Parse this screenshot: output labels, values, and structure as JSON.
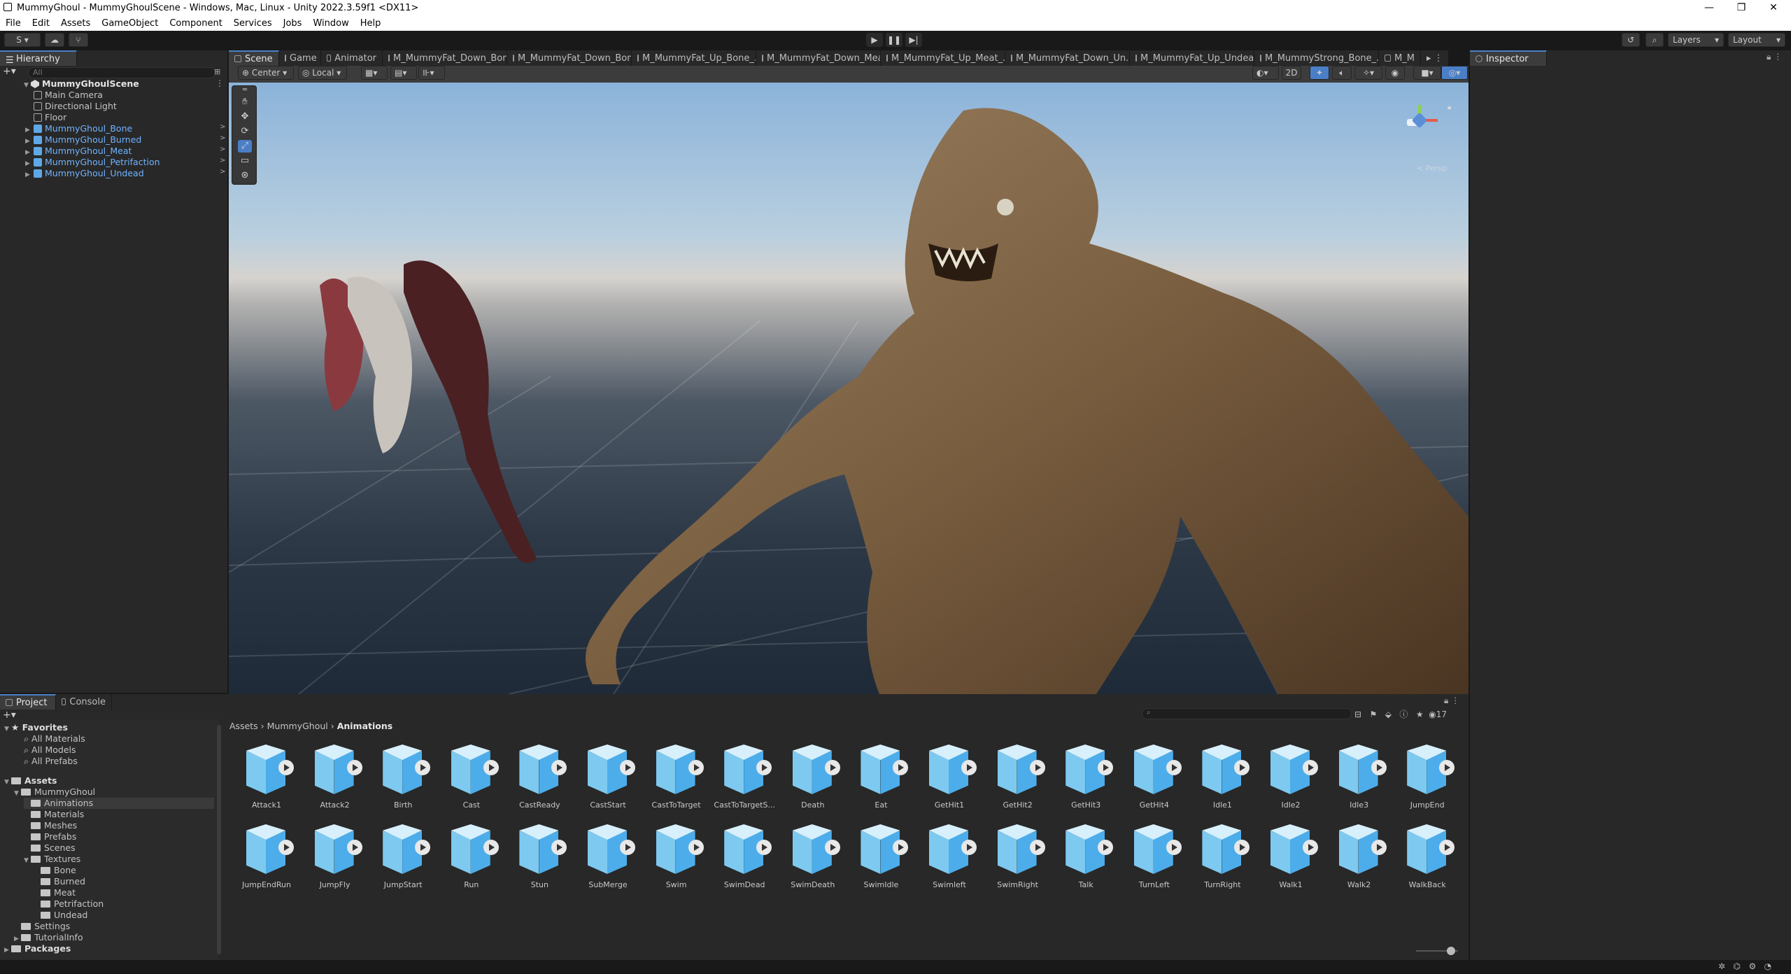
{
  "window": {
    "title": "MummyGhoul - MummyGhoulScene - Windows, Mac, Linux - Unity 2022.3.59f1 <DX11>",
    "controls": [
      "—",
      "❐",
      "✕"
    ]
  },
  "menu": [
    "File",
    "Edit",
    "Assets",
    "GameObject",
    "Component",
    "Services",
    "Jobs",
    "Window",
    "Help"
  ],
  "toolbar": {
    "account": "S",
    "layers_label": "Layers",
    "layout_label": "Layout"
  },
  "hierarchy": {
    "tab": "Hierarchy",
    "search_placeholder": "All",
    "scene_name": "MummyGhoulScene",
    "items": [
      {
        "label": "Main Camera",
        "type": "gameobject"
      },
      {
        "label": "Directional Light",
        "type": "gameobject"
      },
      {
        "label": "Floor",
        "type": "gameobject"
      },
      {
        "label": "MummyGhoul_Bone",
        "type": "prefab"
      },
      {
        "label": "MummyGhoul_Burned",
        "type": "prefab"
      },
      {
        "label": "MummyGhoul_Meat",
        "type": "prefab"
      },
      {
        "label": "MummyGhoul_Petrifaction",
        "type": "prefab"
      },
      {
        "label": "MummyGhoul_Undead",
        "type": "prefab"
      }
    ]
  },
  "scene_tabs": [
    {
      "label": "Scene",
      "active": true
    },
    {
      "label": "Game"
    },
    {
      "label": "Animator"
    },
    {
      "label": "M_MummyFat_Down_Bon..."
    },
    {
      "label": "M_MummyFat_Down_Bon..."
    },
    {
      "label": "M_MummyFat_Up_Bone_..."
    },
    {
      "label": "M_MummyFat_Down_Mea..."
    },
    {
      "label": "M_MummyFat_Up_Meat_..."
    },
    {
      "label": "M_MummyFat_Down_Un..."
    },
    {
      "label": "M_MummyFat_Up_Undea..."
    },
    {
      "label": "M_MummyStrong_Bone_..."
    },
    {
      "label": "M_M"
    }
  ],
  "scene_toolbar": {
    "pivot": "Center",
    "space": "Local",
    "mode_2d": "2D",
    "gizmo_label": "< Persp"
  },
  "inspector": {
    "tab": "Inspector"
  },
  "bottom_tabs": [
    {
      "label": "Project",
      "active": true
    },
    {
      "label": "Console"
    }
  ],
  "project_tree": {
    "favorites": {
      "label": "Favorites",
      "items": [
        "All Materials",
        "All Models",
        "All Prefabs"
      ]
    },
    "assets": {
      "label": "Assets",
      "items": [
        {
          "label": "MummyGhoul",
          "depth": 1
        },
        {
          "label": "Animations",
          "depth": 2,
          "selected": true
        },
        {
          "label": "Materials",
          "depth": 2
        },
        {
          "label": "Meshes",
          "depth": 2
        },
        {
          "label": "Prefabs",
          "depth": 2
        },
        {
          "label": "Scenes",
          "depth": 2
        },
        {
          "label": "Textures",
          "depth": 2
        },
        {
          "label": "Bone",
          "depth": 3
        },
        {
          "label": "Burned",
          "depth": 3
        },
        {
          "label": "Meat",
          "depth": 3
        },
        {
          "label": "Petrifaction",
          "depth": 3
        },
        {
          "label": "Undead",
          "depth": 3
        },
        {
          "label": "Settings",
          "depth": 1
        },
        {
          "label": "TutorialInfo",
          "depth": 1
        }
      ]
    },
    "packages": "Packages"
  },
  "breadcrumb": [
    "Assets",
    "MummyGhoul",
    "Animations"
  ],
  "asset_count": "17",
  "animations": [
    "Attack1",
    "Attack2",
    "Birth",
    "Cast",
    "CastReady",
    "CastStart",
    "CastToTarget",
    "CastToTargetS...",
    "Death",
    "Eat",
    "GetHit1",
    "GetHit2",
    "GetHit3",
    "GetHit4",
    "Idle1",
    "Idle2",
    "Idle3",
    "JumpEnd",
    "JumpEndRun",
    "JumpFly",
    "JumpStart",
    "Run",
    "Stun",
    "SubMerge",
    "Swim",
    "SwimDead",
    "SwimDeath",
    "SwimIdle",
    "Swimleft",
    "SwimRight",
    "Talk",
    "TurnLeft",
    "TurnRight",
    "Walk1",
    "Walk2",
    "WalkBack"
  ],
  "colors": {
    "accent": "#4a7fc8",
    "prefab_text": "#6fb3ff",
    "panel": "#282828",
    "background": "#191919"
  }
}
